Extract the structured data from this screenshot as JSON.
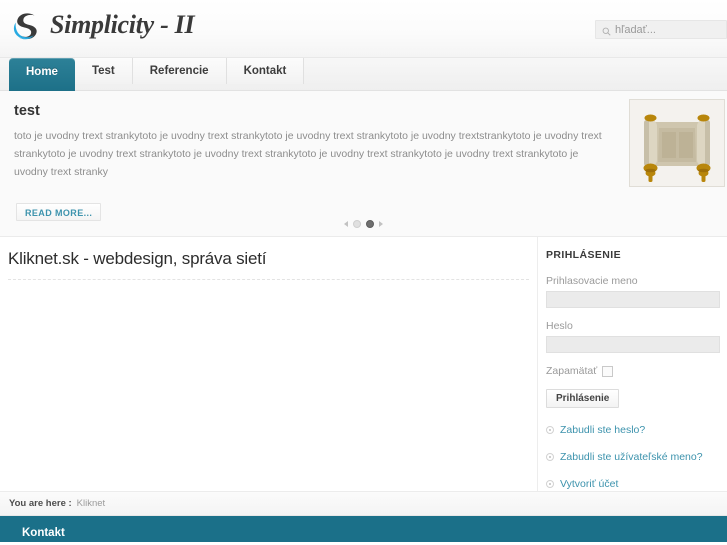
{
  "header": {
    "logo_text": "Simplicity - II",
    "logo_icon": "swirl-s-logo",
    "search": {
      "icon": "search-icon",
      "placeholder": "hľadať...",
      "value": ""
    }
  },
  "nav": {
    "items": [
      {
        "label": "Home",
        "active": true
      },
      {
        "label": "Test",
        "active": false
      },
      {
        "label": "Referencie",
        "active": false
      },
      {
        "label": "Kontakt",
        "active": false
      }
    ]
  },
  "slider": {
    "title": "test",
    "body": "toto je uvodny trext strankytoto je uvodny trext strankytoto je uvodny trext strankytoto je uvodny trextstrankytoto je uvodny trext strankytoto je uvodny trext strankytoto je uvodny trext strankytoto je uvodny trext strankytoto je uvodny trext strankytoto je uvodny trext stranky",
    "read_more_label": "READ MORE...",
    "image_alt": "ancient-torah-scroll",
    "pager": {
      "prev_icon": "chevron-left-icon",
      "next_icon": "chevron-right-icon",
      "dots": [
        {
          "active": false
        },
        {
          "active": true
        }
      ]
    }
  },
  "main": {
    "page_title": "Kliknet.sk - webdesign, správa sietí"
  },
  "sidebar": {
    "title": "PRIHLÁSENIE",
    "username_label": "Prihlasovacie meno",
    "username_value": "",
    "password_label": "Heslo",
    "password_value": "",
    "remember_label": "Zapamätať",
    "remember_checked": false,
    "submit_label": "Prihlásenie",
    "links": [
      {
        "label": "Zabudli ste heslo?",
        "icon": "bullet-icon"
      },
      {
        "label": "Zabudli ste užívateľské meno?",
        "icon": "bullet-icon"
      },
      {
        "label": "Vytvoriť účet",
        "icon": "bullet-icon"
      }
    ]
  },
  "breadcrumb": {
    "label": "You are here :",
    "items": [
      "Kliknet"
    ]
  },
  "footer": {
    "title": "Kontakt"
  },
  "colors": {
    "accent_teal": "#1b7089",
    "link_blue": "#3d93ad",
    "logo_blue": "#29abe2",
    "logo_dark": "#3a3a3a",
    "page_bg": "#ffffff"
  }
}
